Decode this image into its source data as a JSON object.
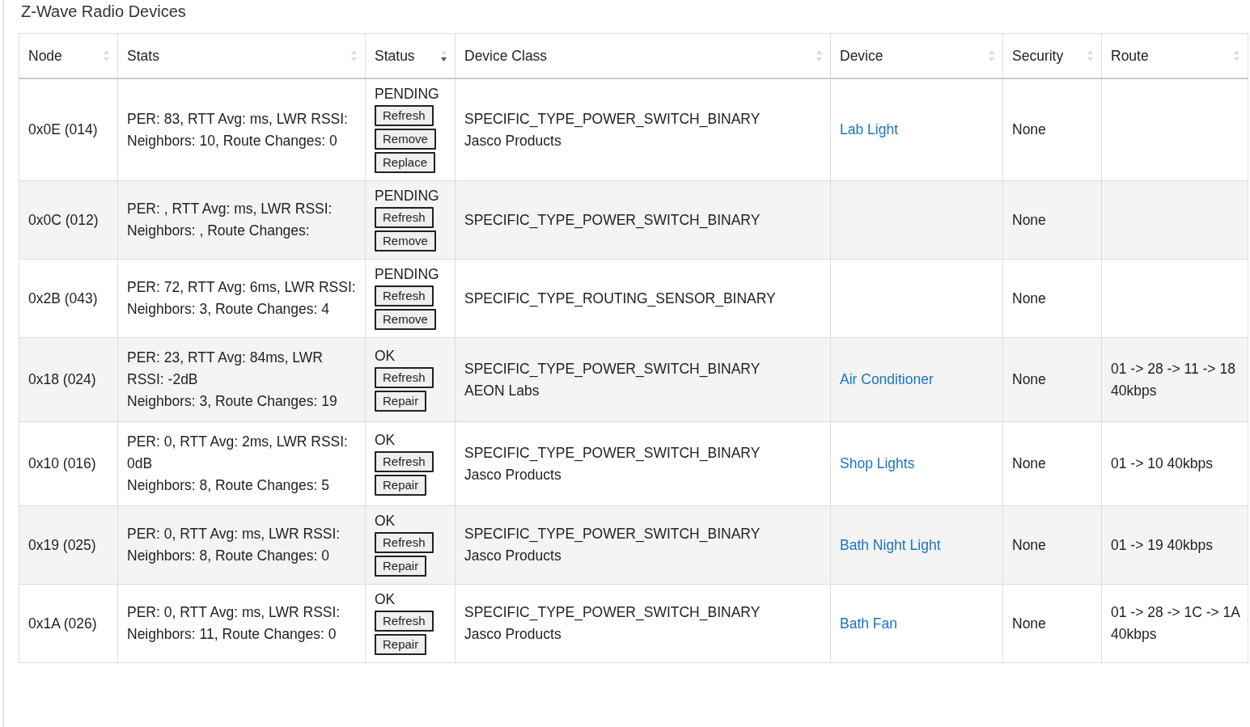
{
  "title": "Z-Wave Radio Devices",
  "columns": [
    {
      "label": "Node",
      "sorted": false
    },
    {
      "label": "Stats",
      "sorted": false
    },
    {
      "label": "Status",
      "sorted": true
    },
    {
      "label": "Device Class",
      "sorted": false
    },
    {
      "label": "Device",
      "sorted": false
    },
    {
      "label": "Security",
      "sorted": false
    },
    {
      "label": "Route",
      "sorted": false
    }
  ],
  "rows": [
    {
      "node": "0x0E (014)",
      "stats": [
        "PER: 83, RTT Avg: ms, LWR RSSI:",
        "Neighbors: 10, Route Changes: 0"
      ],
      "status": "PENDING",
      "buttons": [
        "Refresh",
        "Remove",
        "Replace"
      ],
      "device_class": "SPECIFIC_TYPE_POWER_SWITCH_BINARY",
      "manufacturer": "Jasco Products",
      "device": "Lab Light",
      "security": "None",
      "route": ""
    },
    {
      "node": "0x0C (012)",
      "stats": [
        "PER: , RTT Avg: ms, LWR RSSI:",
        "Neighbors: , Route Changes:"
      ],
      "status": "PENDING",
      "buttons": [
        "Refresh",
        "Remove"
      ],
      "device_class": "SPECIFIC_TYPE_POWER_SWITCH_BINARY",
      "manufacturer": "",
      "device": "",
      "security": "None",
      "route": ""
    },
    {
      "node": "0x2B (043)",
      "stats": [
        "PER: 72, RTT Avg: 6ms, LWR RSSI:",
        "Neighbors: 3, Route Changes: 4"
      ],
      "status": "PENDING",
      "buttons": [
        "Refresh",
        "Remove"
      ],
      "device_class": "SPECIFIC_TYPE_ROUTING_SENSOR_BINARY",
      "manufacturer": "",
      "device": "",
      "security": "None",
      "route": ""
    },
    {
      "node": "0x18 (024)",
      "stats": [
        "PER: 23, RTT Avg: 84ms, LWR RSSI: -2dB",
        "Neighbors: 3, Route Changes: 19"
      ],
      "status": "OK",
      "buttons": [
        "Refresh",
        "Repair"
      ],
      "device_class": "SPECIFIC_TYPE_POWER_SWITCH_BINARY",
      "manufacturer": "AEON Labs",
      "device": "Air Conditioner",
      "security": "None",
      "route": "01 -> 28 -> 11 -> 18 40kbps"
    },
    {
      "node": "0x10 (016)",
      "stats": [
        "PER: 0, RTT Avg: 2ms, LWR RSSI: 0dB",
        "Neighbors: 8, Route Changes: 5"
      ],
      "status": "OK",
      "buttons": [
        "Refresh",
        "Repair"
      ],
      "device_class": "SPECIFIC_TYPE_POWER_SWITCH_BINARY",
      "manufacturer": "Jasco Products",
      "device": "Shop Lights",
      "security": "None",
      "route": "01 -> 10 40kbps"
    },
    {
      "node": "0x19 (025)",
      "stats": [
        "PER: 0, RTT Avg: ms, LWR RSSI:",
        "Neighbors: 8, Route Changes: 0"
      ],
      "status": "OK",
      "buttons": [
        "Refresh",
        "Repair"
      ],
      "device_class": "SPECIFIC_TYPE_POWER_SWITCH_BINARY",
      "manufacturer": "Jasco Products",
      "device": "Bath Night Light",
      "security": "None",
      "route": "01 -> 19 40kbps"
    },
    {
      "node": "0x1A (026)",
      "stats": [
        "PER: 0, RTT Avg: ms, LWR RSSI:",
        "Neighbors: 11, Route Changes: 0"
      ],
      "status": "OK",
      "buttons": [
        "Refresh",
        "Repair"
      ],
      "device_class": "SPECIFIC_TYPE_POWER_SWITCH_BINARY",
      "manufacturer": "Jasco Products",
      "device": "Bath Fan",
      "security": "None",
      "route": "01 -> 28 -> 1C -> 1A 40kbps"
    }
  ]
}
